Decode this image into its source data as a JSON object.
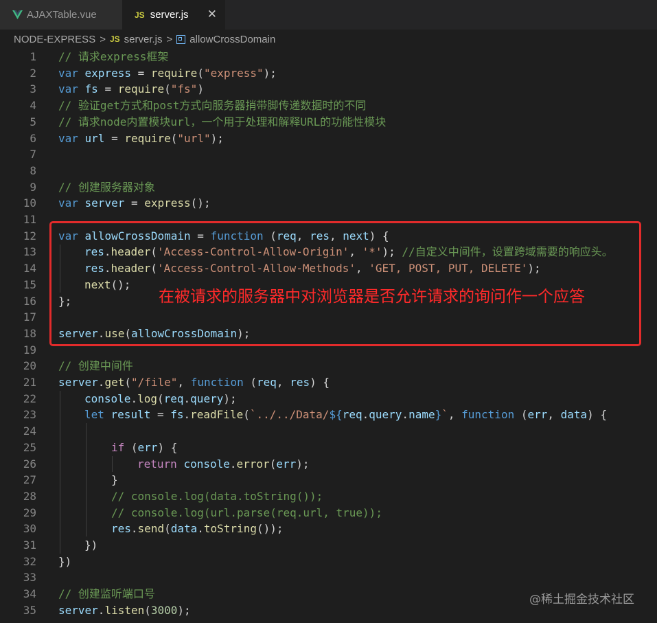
{
  "tabs": [
    {
      "label": "AJAXTable.vue",
      "icon": "vue-icon"
    },
    {
      "label": "server.js",
      "icon": "js-icon",
      "icon_text": "JS",
      "close": "✕"
    }
  ],
  "breadcrumb": {
    "folder": "NODE-EXPRESS",
    "file_icon_text": "JS",
    "file": "server.js",
    "symbol": "allowCrossDomain",
    "separator": ">"
  },
  "line_numbers": [
    "1",
    "2",
    "3",
    "4",
    "5",
    "6",
    "7",
    "8",
    "9",
    "10",
    "11",
    "12",
    "13",
    "14",
    "15",
    "16",
    "17",
    "18",
    "19",
    "20",
    "21",
    "22",
    "23",
    "24",
    "25",
    "26",
    "27",
    "28",
    "29",
    "30",
    "31",
    "32",
    "33",
    "34",
    "35"
  ],
  "code": {
    "l1": "// 请求express框架",
    "l2": [
      "var",
      " express ",
      "= ",
      "require",
      "(",
      "\"express\"",
      ");"
    ],
    "l3": [
      "var",
      " fs ",
      "= ",
      "require",
      "(",
      "\"fs\"",
      ")"
    ],
    "l4": "// 验证get方式和post方式向服务器捎带脚传递数据时的不同",
    "l5": "// 请求node内置模块url，一个用于处理和解释URL的功能性模块",
    "l6": [
      "var",
      " url ",
      "= ",
      "require",
      "(",
      "\"url\"",
      ");"
    ],
    "l9": "// 创建服务器对象",
    "l10": [
      "var",
      " server ",
      "= ",
      "express",
      "();"
    ],
    "l12": [
      "var",
      " allowCrossDomain ",
      "= ",
      "function",
      " (",
      "req",
      ", ",
      "res",
      ", ",
      "next",
      ") {"
    ],
    "l13": [
      "res",
      ".",
      "header",
      "(",
      "'Access-Control-Allow-Origin'",
      ", ",
      "'*'",
      "); ",
      "//自定义中间件，设置跨域需要的响应头。"
    ],
    "l14": [
      "res",
      ".",
      "header",
      "(",
      "'Access-Control-Allow-Methods'",
      ", ",
      "'GET, POST, PUT, DELETE'",
      ");"
    ],
    "l15": [
      "next",
      "();"
    ],
    "l16": "};",
    "l18": [
      "server",
      ".",
      "use",
      "(",
      "allowCrossDomain",
      ");"
    ],
    "l20": "// 创建中间件",
    "l21": [
      "server",
      ".",
      "get",
      "(",
      "\"/file\"",
      ", ",
      "function",
      " (",
      "req",
      ", ",
      "res",
      ") {"
    ],
    "l22": [
      "console",
      ".",
      "log",
      "(",
      "req",
      ".",
      "query",
      ");"
    ],
    "l23": [
      "let",
      " result ",
      "= ",
      "fs",
      ".",
      "readFile",
      "(",
      "`../../Data/",
      "${",
      "req",
      ".",
      "query",
      ".",
      "name",
      "}",
      "`",
      ", ",
      "function",
      " (",
      "err",
      ", ",
      "data",
      ") {"
    ],
    "l25": [
      "if",
      " (",
      "err",
      ") {"
    ],
    "l26": [
      "return",
      " ",
      "console",
      ".",
      "error",
      "(",
      "err",
      ");"
    ],
    "l27": "}",
    "l28": "// console.log(data.toString());",
    "l29": "// console.log(url.parse(req.url, true));",
    "l30": [
      "res",
      ".",
      "send",
      "(",
      "data",
      ".",
      "toString",
      "());"
    ],
    "l31": "})",
    "l32": "})",
    "l34": "// 创建监听端口号",
    "l35": [
      "server",
      ".",
      "listen",
      "(",
      "3000",
      ");"
    ]
  },
  "annotation": "在被请求的服务器中对浏览器是否允许请求的询问作一个应答",
  "watermark": "@稀土掘金技术社区",
  "colors": {
    "keyword": "#569cd6",
    "variable": "#9cdcfe",
    "function": "#dcdcaa",
    "string": "#ce9178",
    "comment": "#6a9955",
    "number": "#b5cea8",
    "control": "#c586c0",
    "highlight_box": "#e22b2b"
  }
}
